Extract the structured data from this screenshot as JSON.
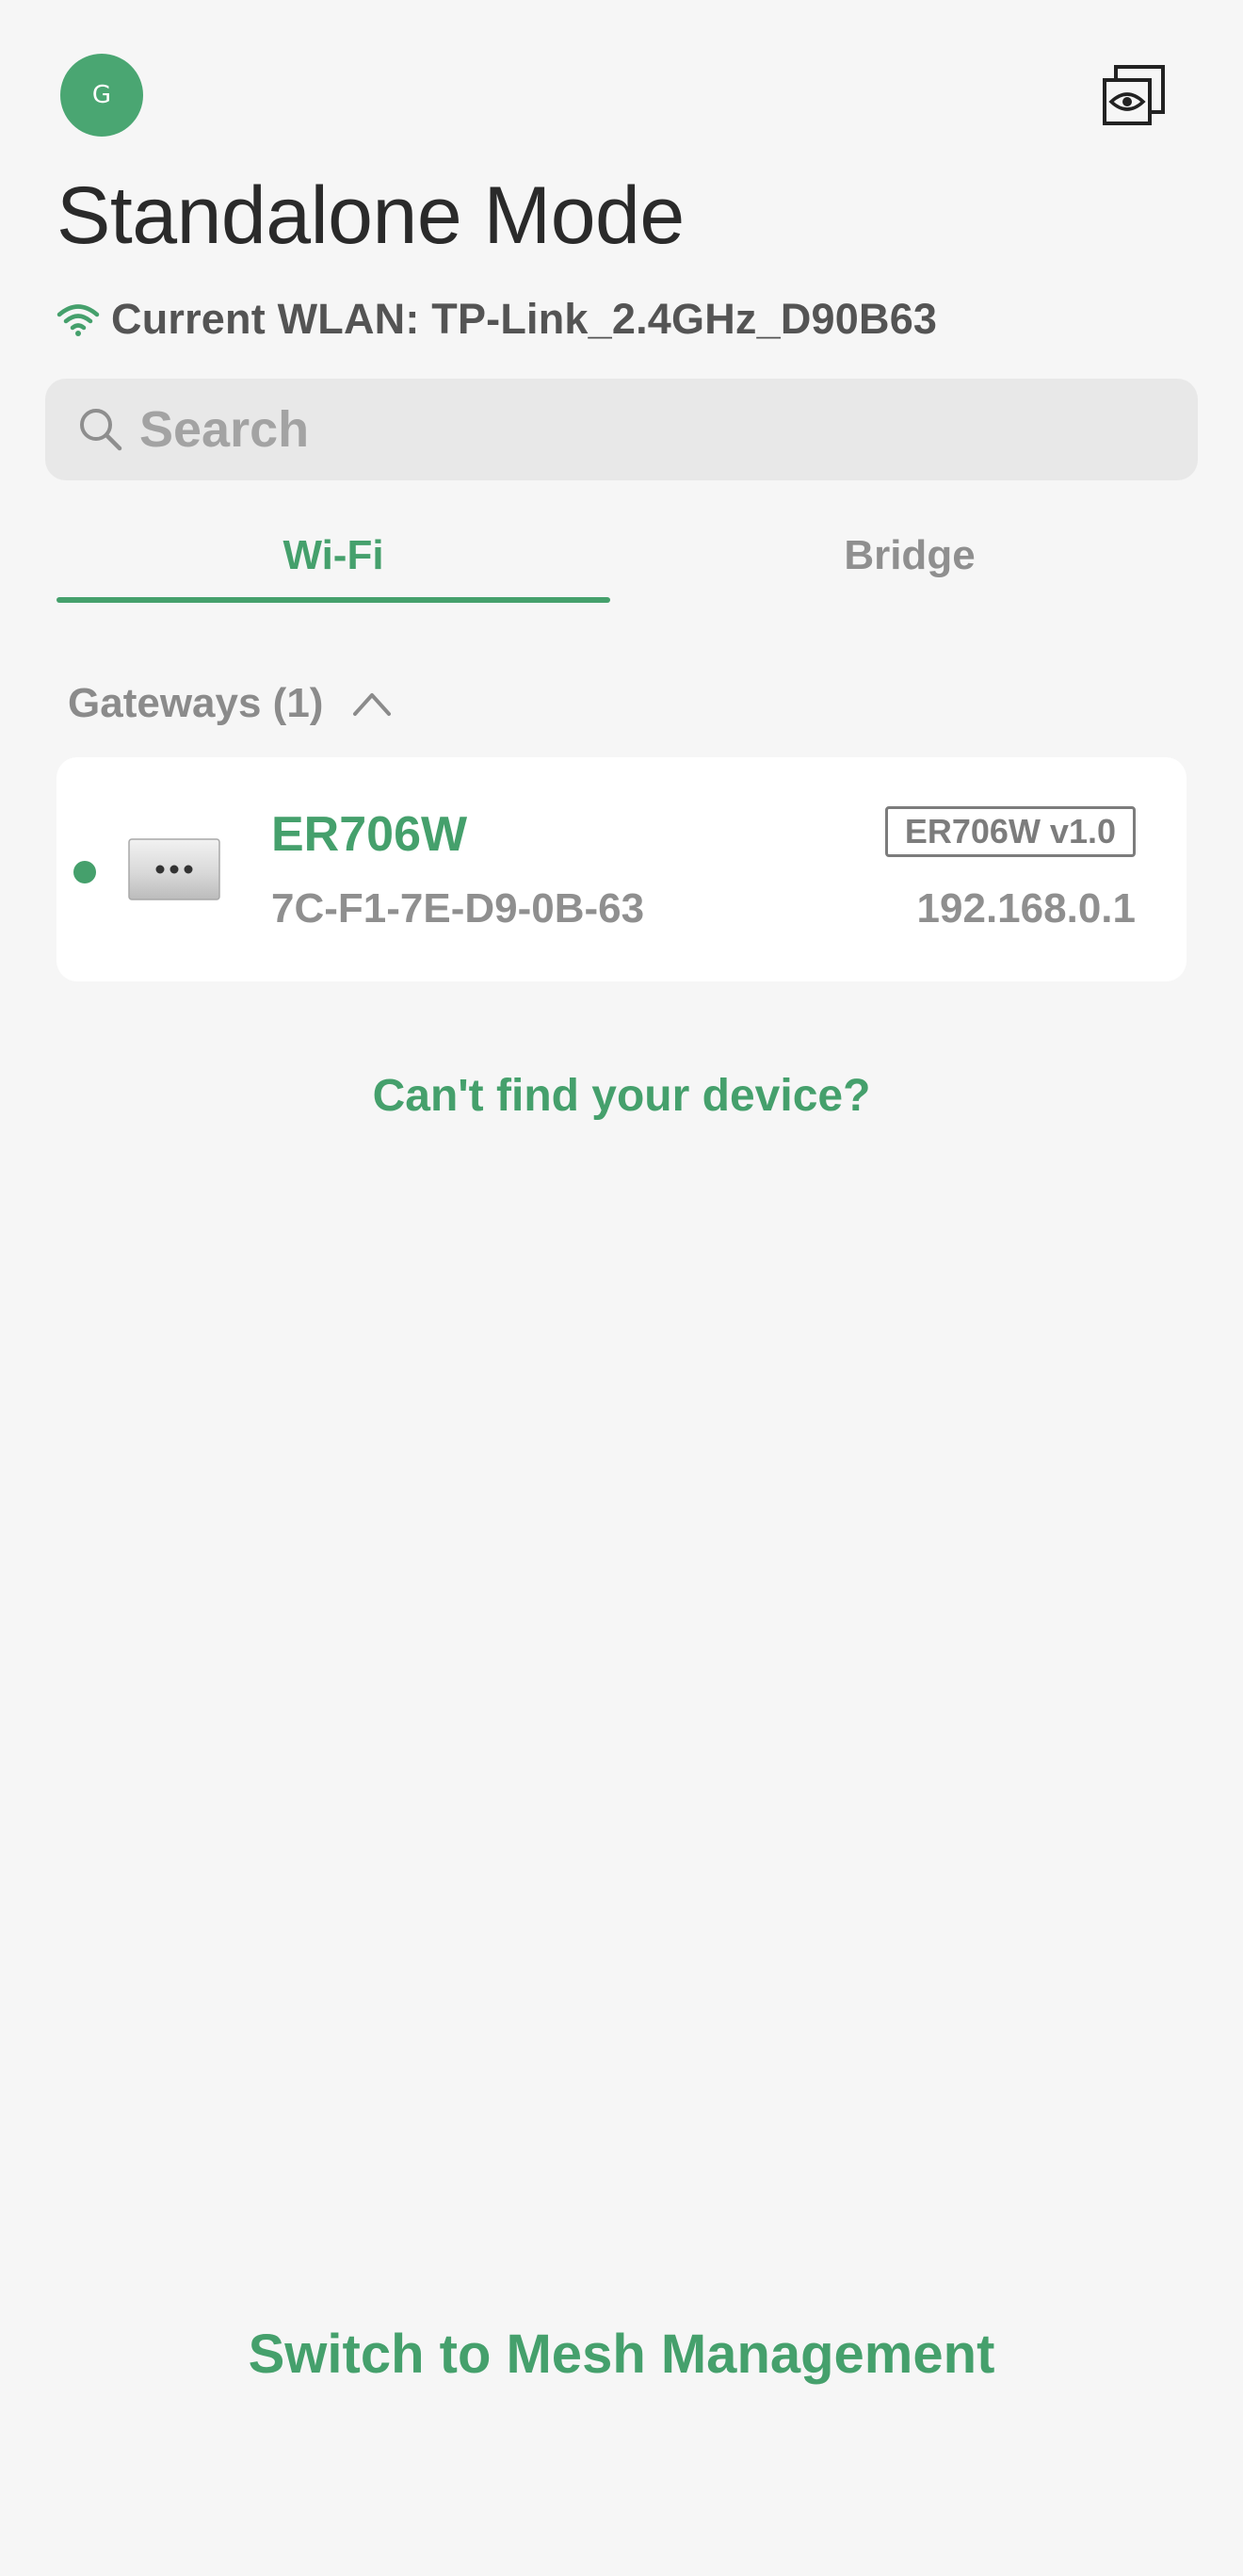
{
  "header": {
    "avatar_initial": "G",
    "view_icon": "eye-window-icon",
    "title": "Standalone Mode",
    "wlan_label": "Current WLAN: TP-Link_2.4GHz_D90B63",
    "wlan_icon": "wifi-icon"
  },
  "search": {
    "placeholder": "Search",
    "value": ""
  },
  "tabs": [
    {
      "label": "Wi-Fi",
      "active": true
    },
    {
      "label": "Bridge",
      "active": false
    }
  ],
  "sections": [
    {
      "label": "Gateways (1)",
      "expanded": true,
      "devices": [
        {
          "name": "ER706W",
          "mac": "7C-F1-7E-D9-0B-63",
          "model": "ER706W v1.0",
          "ip": "192.168.0.1",
          "status": "online"
        }
      ]
    }
  ],
  "links": {
    "cant_find": "Can't find your device?",
    "switch_mesh": "Switch to Mesh Management"
  },
  "colors": {
    "accent": "#45a06c",
    "avatar": "#4aa672",
    "background": "#f6f6f6"
  }
}
